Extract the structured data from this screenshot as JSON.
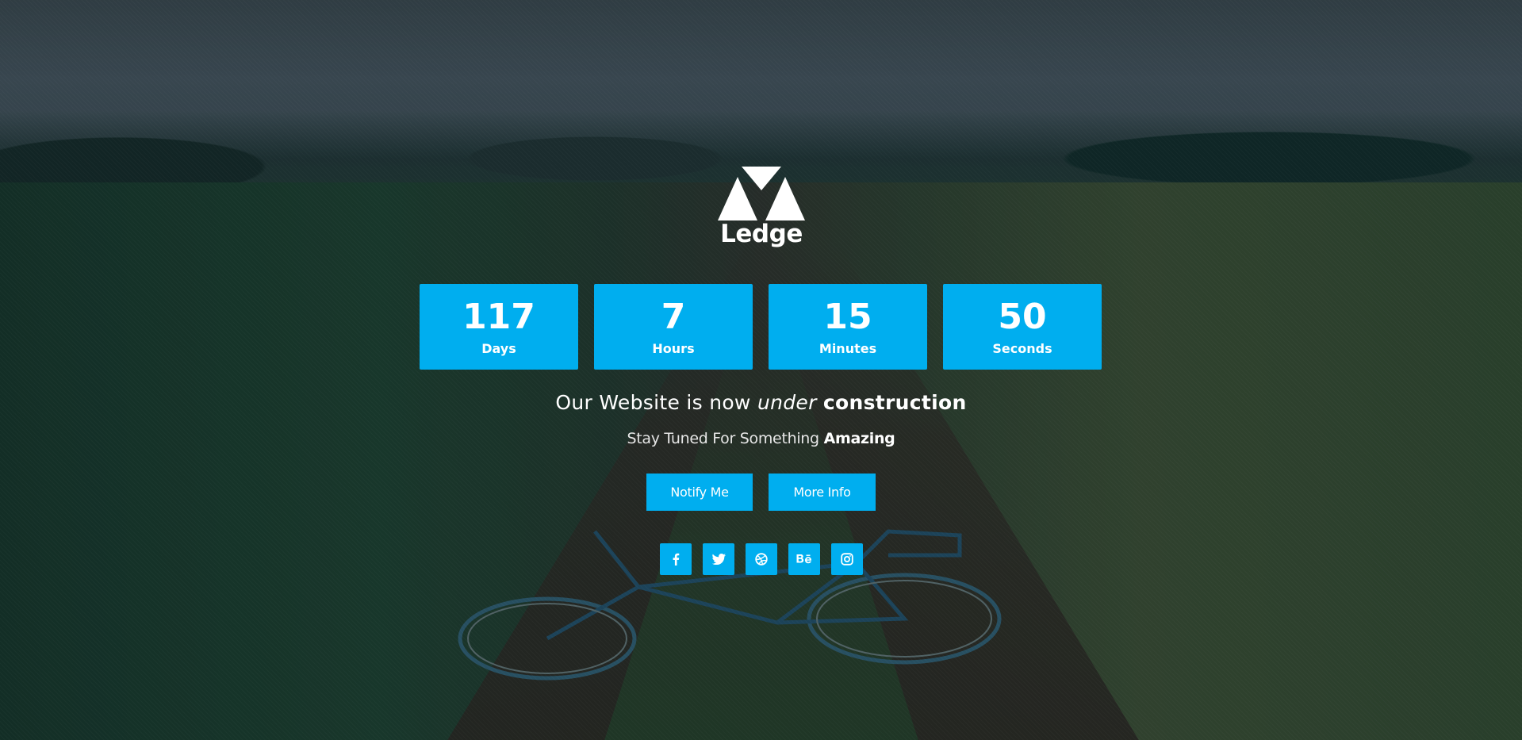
{
  "brand": {
    "name": "Ledge",
    "logo_icon": "ledge-triangles-logo"
  },
  "countdown": [
    {
      "value": "117",
      "label": "Days"
    },
    {
      "value": "7",
      "label": "Hours"
    },
    {
      "value": "15",
      "label": "Minutes"
    },
    {
      "value": "50",
      "label": "Seconds"
    }
  ],
  "headline": {
    "part1": "Our Website is now ",
    "part2": "under",
    "part3": " ",
    "part4": "construction"
  },
  "subline": {
    "part1": "Stay Tuned For Something ",
    "part2": "Amazing"
  },
  "buttons": {
    "notify_label": "Notify Me",
    "more_label": "More Info"
  },
  "social": [
    {
      "icon": "facebook-icon"
    },
    {
      "icon": "twitter-icon"
    },
    {
      "icon": "dribbble-icon"
    },
    {
      "icon": "behance-icon"
    },
    {
      "icon": "instagram-icon"
    }
  ],
  "colors": {
    "accent": "#00aeef",
    "text": "#ffffff"
  }
}
